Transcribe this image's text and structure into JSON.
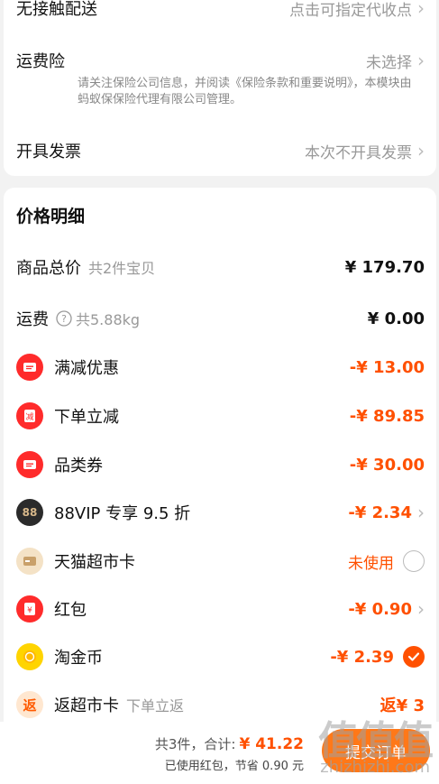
{
  "delivery": {
    "contactless": {
      "label": "无接触配送",
      "value": "点击可指定代收点"
    },
    "insurance": {
      "label": "运费险",
      "value": "未选择",
      "note": "请关注保险公司信息，并阅读《保险条款和重要说明》，本模块由蚂蚁保保险代理有限公司管理。"
    },
    "invoice": {
      "label": "开具发票",
      "value": "本次不开具发票"
    }
  },
  "price_detail": {
    "title": "价格明细",
    "items": [
      {
        "label": "商品总价",
        "sub": "共2件宝贝",
        "amount": "¥ 179.70"
      },
      {
        "label": "运费",
        "sub": "共5.88kg",
        "amount": "¥ 0.00"
      },
      {
        "label": "满减优惠",
        "amount": "-¥ 13.00",
        "icon": "coupon-icon"
      },
      {
        "label": "下单立减",
        "amount": "-¥ 89.85",
        "icon": "discount-icon"
      },
      {
        "label": "品类券",
        "amount": "-¥ 30.00",
        "icon": "coupon-icon"
      },
      {
        "label": "88VIP 专享 9.5 折",
        "amount": "-¥ 2.34",
        "icon": "vip-88-icon",
        "icon_text": "88"
      },
      {
        "label": "天猫超市卡",
        "amount": "未使用",
        "icon": "card-icon"
      },
      {
        "label": "红包",
        "amount": "-¥ 0.90",
        "icon": "red-packet-icon"
      },
      {
        "label": "淘金币",
        "amount": "-¥ 2.39",
        "icon": "gold-coin-icon"
      },
      {
        "label": "返超市卡",
        "sub": "下单立返",
        "amount": "返¥ 3",
        "icon": "rebate-icon",
        "icon_text": "返"
      }
    ]
  },
  "footer": {
    "count": "共3件，",
    "total_label": "合计:",
    "total_amount": "¥ 41.22",
    "saved": "已使用红包，节省 0.90 元",
    "submit_label": "提交订单"
  },
  "watermark": {
    "text": "值值值",
    "site": "zhizhizhi.com"
  },
  "colors": {
    "accent": "#ff5000",
    "red": "#ff2b2b"
  }
}
